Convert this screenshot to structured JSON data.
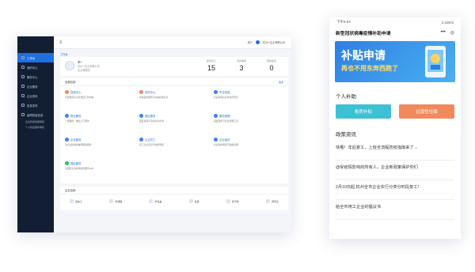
{
  "admin": {
    "logo": "...",
    "company": "杭州**企业有限公司",
    "user": "用户",
    "breadcrumb": "工作台",
    "sidebar": [
      {
        "label": "工作台"
      },
      {
        "label": "我的中心"
      },
      {
        "label": "服务中心"
      },
      {
        "label": "企业服务"
      },
      {
        "label": "企业资讯"
      },
      {
        "label": "信息发布"
      },
      {
        "label": "疫情防疫信息"
      }
    ],
    "sidebar_sub": [
      "企业防疫情报审核",
      "个人防疫事件审核"
    ],
    "profile": {
      "name": "李**",
      "line1": "杭州**企业有限公司",
      "line2": "企业管理员"
    },
    "stats": [
      {
        "label": "我的员工",
        "value": "15"
      },
      {
        "label": "待办事项",
        "value": "3"
      },
      {
        "label": "我的会员",
        "value": "0"
      }
    ],
    "services_title": "全部应用",
    "services_more": "更多",
    "services": [
      {
        "title": "党政中心",
        "desc": "查询党员信息及党建工作内容",
        "color": "#f08a5d"
      },
      {
        "title": "政务中心",
        "desc": "查看政务服务与办事指南信息",
        "color": "#f08a5d"
      },
      {
        "title": "车位信息",
        "desc": "企业车位信息查询与登记",
        "color": "#3b82f6"
      },
      {
        "title": "物业服务",
        "desc": "一键报修，物业上门服务",
        "color": "#3b82f6"
      },
      {
        "title": "园区服务",
        "desc": "园区资源与活动信息查询",
        "color": "#3b82f6"
      },
      {
        "title": "服务管理",
        "desc": "园区服务与企业管理工具",
        "color": "#3b82f6"
      },
      {
        "title": "企业服务",
        "desc": "为企业提供政策申报等服务",
        "color": "#3b82f6"
      },
      {
        "title": "企业员工",
        "desc": "员工信息登记与健康申报",
        "color": "#3b82f6"
      },
      {
        "title": "企业留存",
        "desc": "企业资料留存与档案管理",
        "color": "#3b82f6"
      },
      {
        "title": "园区服务",
        "desc": "为园区企业提供综合服务APP",
        "color": "#22c55e"
      }
    ],
    "apps_title": "企业应用",
    "apps": [
      "发帖子",
      "学课程",
      "学包裹",
      "发票",
      "通讯录",
      "调查表"
    ]
  },
  "mobile": {
    "time": "下午5:04",
    "status_right": "2.53K/s",
    "title": "新型冠状病毒疫情补助申请",
    "banner_title": "补贴申请",
    "banner_sub": "再也不用东奔西跑了",
    "section_subsidy": "个人补助",
    "btn_a": "租房补贴",
    "btn_b": "过渡性住宿",
    "news_title": "政策资讯",
    "news": [
      {
        "title": "快看！年后复工，上班全流程防疫指南来了→",
        "date": "..."
      },
      {
        "title": "@受疫情影响的所有人，企业新政策保护你们",
        "date": "..."
      },
      {
        "title": "2月10日起,杭州全市企业实行分类分时段复工!",
        "date": "..."
      },
      {
        "title": "给全市用工企业的倡议书",
        "date": "..."
      }
    ]
  }
}
